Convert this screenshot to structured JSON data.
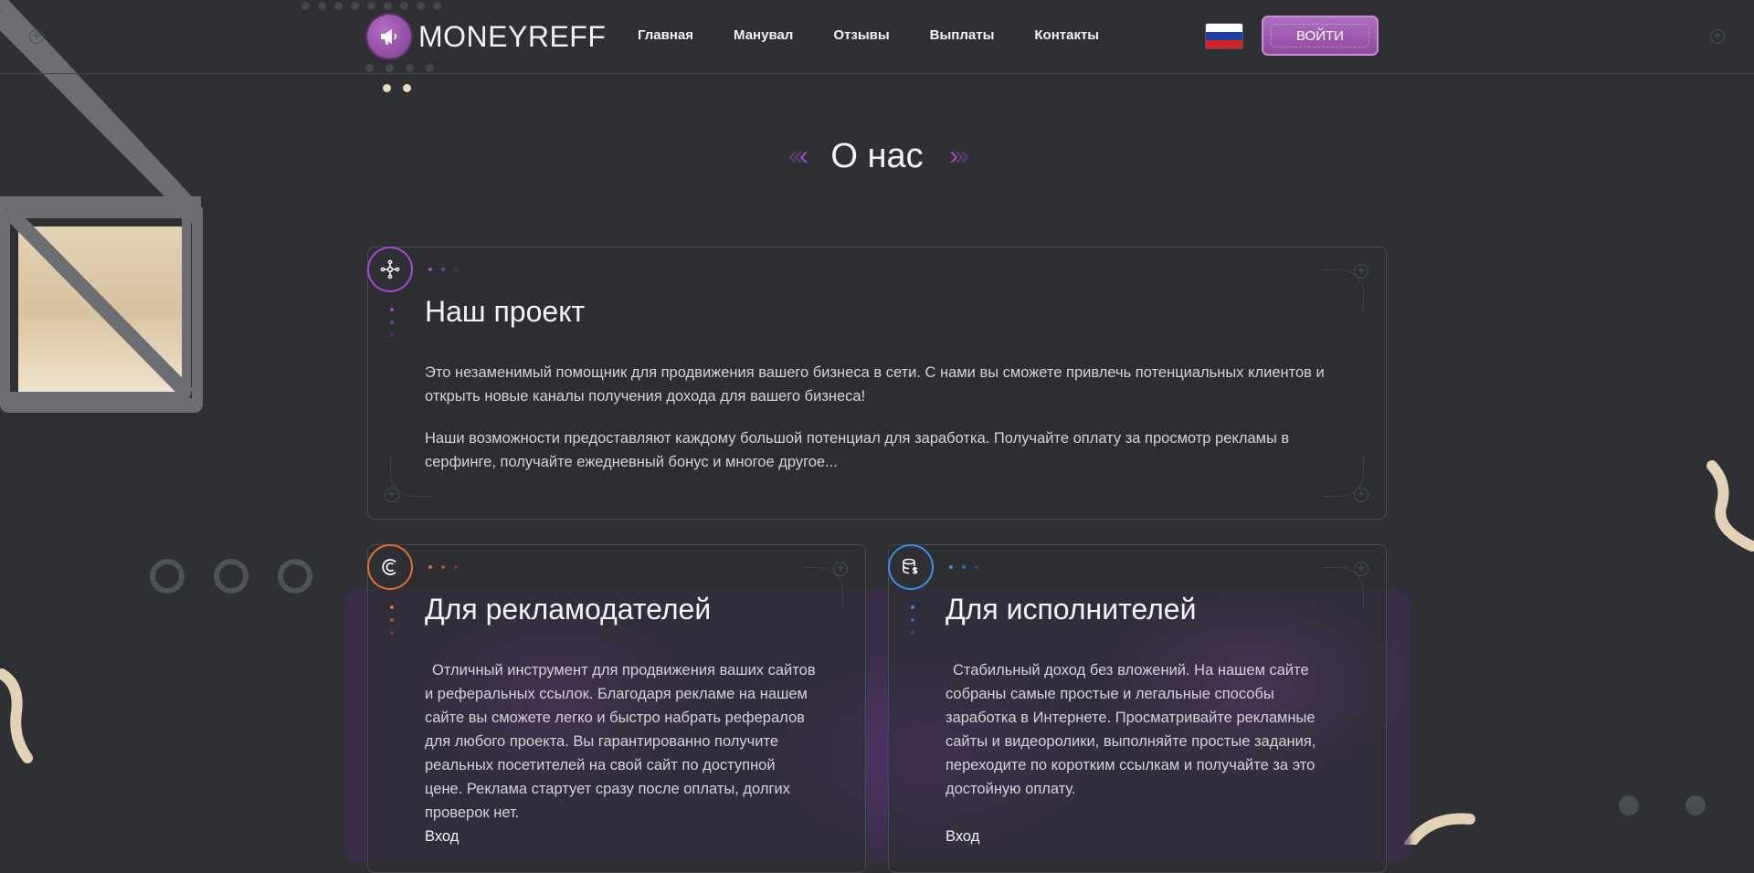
{
  "header": {
    "logo_text": "MONEYREFF",
    "nav": [
      "Главная",
      "Манувал",
      "Отзывы",
      "Выплаты",
      "Контакты"
    ],
    "login_label": "ВОЙТИ",
    "flag_colors": [
      "#ffffff",
      "#1c3fa8",
      "#d3232a"
    ]
  },
  "section": {
    "title": "О нас"
  },
  "cards": {
    "project": {
      "title": "Наш проект",
      "p1": "Это незаменимый помощник для продвижения вашего бизнеса в сети. С нами вы сможете привлечь потенциальных клиентов и открыть новые каналы получения дохода для вашего бизнеса!",
      "p2": "Наши возможности предоставляют каждому большой потенциал для заработка. Получайте оплату за просмотр рекламы в серфинге, получайте ежедневный бонус и многое другое...",
      "icon": "network-icon",
      "accent": "#a34bd1"
    },
    "advertisers": {
      "title": "Для рекламодателей",
      "text": "Отличный инструмент для продвижения ваших сайтов и реферальных ссылок. Благодаря рекламе на нашем сайте вы сможете легко и быстро набрать рефералов для любого проекта. Вы гарантированно получите реальных посетителей на свой сайт по доступной цене. Реклама стартует сразу после оплаты, долгих проверок нет.",
      "link": "Вход",
      "icon": "credit-icon",
      "accent": "#e0702c"
    },
    "performers": {
      "title": "Для исполнителей",
      "text": "Стабильный доход без вложений. На нашем сайте собраны самые простые и легальные способы заработка в Интернете. Просматривайте рекламные сайты и видеоролики, выполняйте простые задания, переходите по коротким ссылкам и получайте за это достойную оплату.",
      "link": "Вход",
      "icon": "database-dollar-icon",
      "accent": "#3d8fe6"
    }
  }
}
